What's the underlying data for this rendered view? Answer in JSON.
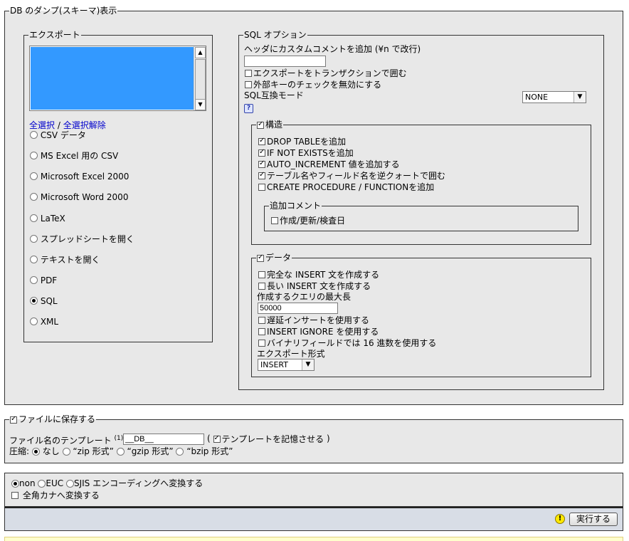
{
  "dump": {
    "legend": "DB のダンプ(スキーマ)表示",
    "export": {
      "legend": "エクスポート",
      "select_all": "全選択",
      "separator": " / ",
      "deselect_all": "全選択解除",
      "formats": [
        {
          "label": "CSV データ",
          "checked": false
        },
        {
          "label": "MS Excel 用の CSV",
          "checked": false
        },
        {
          "label": "Microsoft Excel 2000",
          "checked": false
        },
        {
          "label": "Microsoft Word 2000",
          "checked": false
        },
        {
          "label": "LaTeX",
          "checked": false
        },
        {
          "label": "スプレッドシートを開く",
          "checked": false
        },
        {
          "label": "テキストを開く",
          "checked": false
        },
        {
          "label": "PDF",
          "checked": false
        },
        {
          "label": "SQL",
          "checked": true
        },
        {
          "label": "XML",
          "checked": false
        }
      ]
    },
    "sql": {
      "legend": "SQL オプション",
      "header_comment_label": "ヘッダにカスタムコメントを追加 (¥n で改行)",
      "header_comment_value": "",
      "use_transaction": "エクスポートをトランザクションで囲む",
      "disable_fk": "外部キーのチェックを無効にする",
      "compat_label": "SQL互換モード",
      "compat_value": "NONE",
      "help_icon": "?",
      "structure": {
        "legend": "構造",
        "options": [
          {
            "label": "DROP TABLEを追加",
            "checked": true
          },
          {
            "label": "IF NOT EXISTSを追加",
            "checked": true
          },
          {
            "label": "AUTO_INCREMENT 値を追加する",
            "checked": true
          },
          {
            "label": "テーブル名やフィールド名を逆クォートで囲む",
            "checked": true
          },
          {
            "label": "CREATE PROCEDURE / FUNCTIONを追加",
            "checked": false
          }
        ],
        "comments": {
          "legend": "追加コメント",
          "option": "作成/更新/検査日"
        }
      },
      "data": {
        "legend": "データ",
        "complete_insert": "完全な INSERT 文を作成する",
        "extended_insert": "長い INSERT 文を作成する",
        "max_query_label": "作成するクエリの最大長",
        "max_query_value": "50000",
        "delayed_insert": "遅延インサートを使用する",
        "insert_ignore": "INSERT IGNORE を使用する",
        "hex_binary": "バイナリフィールドでは 16 進数を使用する",
        "export_type_label": "エクスポート形式",
        "export_type_value": "INSERT"
      }
    }
  },
  "save": {
    "legend": "ファイルに保存する",
    "template_label": "ファイル名のテンプレート",
    "template_sup": "(1)",
    "template_colon": ":",
    "template_value": "__DB__",
    "remember_open": "(",
    "remember_label": "テンプレートを記憶させる",
    "remember_close": ")",
    "compression_label": "圧縮:",
    "compression_options": [
      {
        "label": "なし",
        "checked": true
      },
      {
        "label": "“zip 形式”",
        "checked": false
      },
      {
        "label": "“gzip 形式”",
        "checked": false
      },
      {
        "label": "“bzip 形式”",
        "checked": false
      }
    ]
  },
  "encoding": {
    "options": [
      {
        "label": "non",
        "checked": true
      },
      {
        "label": "EUC",
        "checked": false
      },
      {
        "label": "SJIS",
        "checked": false
      }
    ],
    "suffix": "エンコーディングへ変換する",
    "kana_label": "全角カナへ変換する"
  },
  "footer": {
    "go_button": "実行する"
  },
  "colors": {
    "list_selected": "#3399ff",
    "panel_bg": "#e8e8e8",
    "footer_bg": "#d8dde6",
    "bottom_strip": "#ffffcc"
  }
}
